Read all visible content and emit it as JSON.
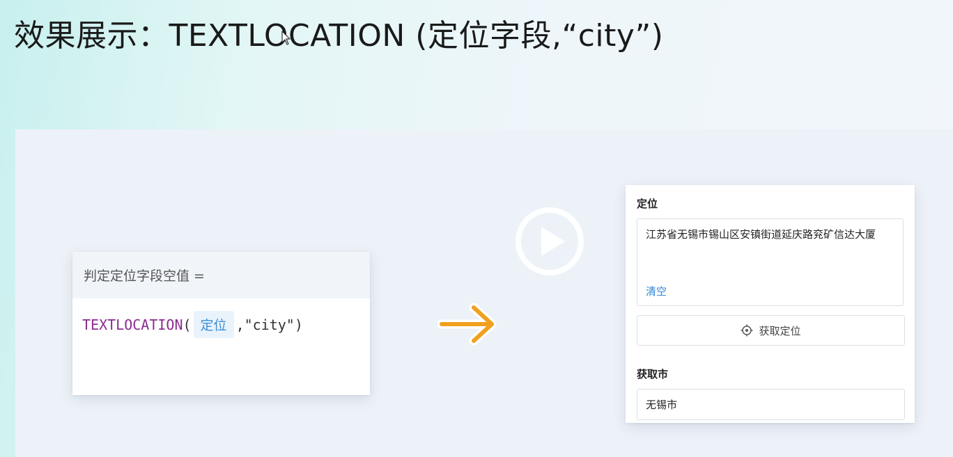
{
  "slide": {
    "title": "效果展示：TEXTLOCATION (定位字段,“city”)"
  },
  "formula": {
    "header": "判定定位字段空值 =",
    "function_name": "TEXTLOCATION",
    "open_paren": "(",
    "field_chip": "定位",
    "argument": ",\"city\")"
  },
  "form": {
    "location_label": "定位",
    "location_value": "江苏省无锡市锡山区安镇街道延庆路兖矿信达大厦",
    "clear_link": "清空",
    "get_location_button": "获取定位",
    "city_label": "获取市",
    "city_value": "无锡市"
  },
  "icons": {
    "arrow": "right-arrow-icon",
    "play": "play-icon",
    "locate": "crosshair-icon",
    "cursor": "mouse-pointer-icon"
  },
  "colors": {
    "function": "#8a2b90",
    "field_chip_text": "#3d8fd6",
    "field_chip_bg": "#e9f3fc",
    "link": "#2f86d6",
    "arrow": "#f0a01e"
  }
}
